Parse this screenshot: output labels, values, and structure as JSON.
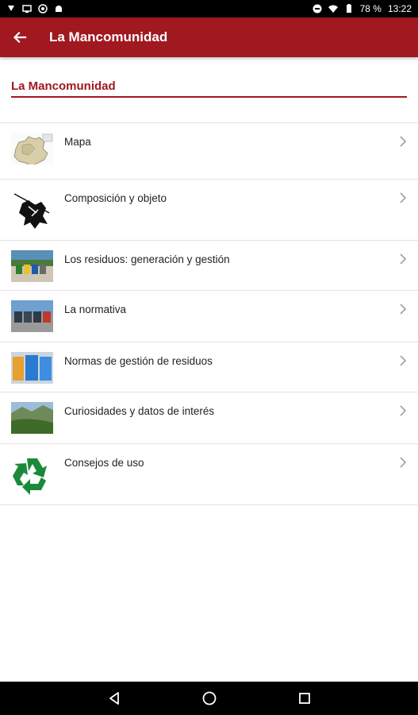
{
  "status_bar": {
    "battery": "78 %",
    "time": "13:22"
  },
  "app_bar": {
    "title": "La Mancomunidad",
    "back_icon": "arrow-back-icon",
    "color": "#a01820"
  },
  "section": {
    "heading": "La Mancomunidad"
  },
  "menu": {
    "items": [
      {
        "label": "Mapa",
        "icon": "map-thumbnail"
      },
      {
        "label": "Composición y objeto",
        "icon": "composition-thumbnail"
      },
      {
        "label": "Los residuos: generación y gestión",
        "icon": "waste-containers-thumbnail"
      },
      {
        "label": "La normativa",
        "icon": "regulation-thumbnail"
      },
      {
        "label": "Normas de gestión de residuos",
        "icon": "bins-thumbnail"
      },
      {
        "label": "Curiosidades y datos de interés",
        "icon": "landscape-thumbnail"
      },
      {
        "label": "Consejos de uso",
        "icon": "recycle-icon"
      }
    ]
  },
  "nav_bar": {
    "back": "nav-back-icon",
    "home": "nav-home-icon",
    "recents": "nav-recents-icon"
  }
}
